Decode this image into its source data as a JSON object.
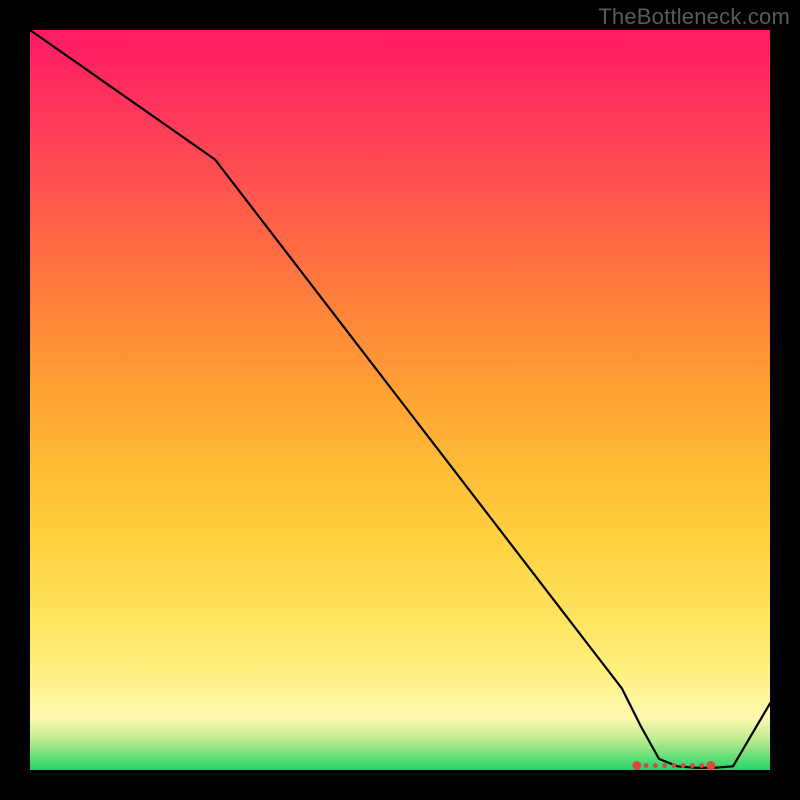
{
  "attribution": "TheBottleneck.com",
  "chart_data": {
    "type": "line",
    "title": "",
    "xlabel": "",
    "ylabel": "",
    "x": [
      0.0,
      0.05,
      0.1,
      0.15,
      0.2,
      0.25,
      0.3,
      0.35,
      0.4,
      0.45,
      0.5,
      0.55,
      0.6,
      0.65,
      0.7,
      0.75,
      0.8,
      0.825,
      0.85,
      0.875,
      0.9,
      0.925,
      0.95,
      1.0
    ],
    "values": [
      1.0,
      0.965,
      0.93,
      0.895,
      0.86,
      0.825,
      0.76,
      0.695,
      0.63,
      0.565,
      0.5,
      0.435,
      0.37,
      0.305,
      0.24,
      0.175,
      0.11,
      0.06,
      0.015,
      0.005,
      0.003,
      0.003,
      0.005,
      0.09
    ],
    "xlim": [
      0,
      1
    ],
    "ylim": [
      0,
      1
    ],
    "marker_region": {
      "x0": 0.82,
      "x1": 0.92,
      "y": 0.006
    },
    "marker_color": "#d84a3c",
    "line_color": "#000000"
  }
}
